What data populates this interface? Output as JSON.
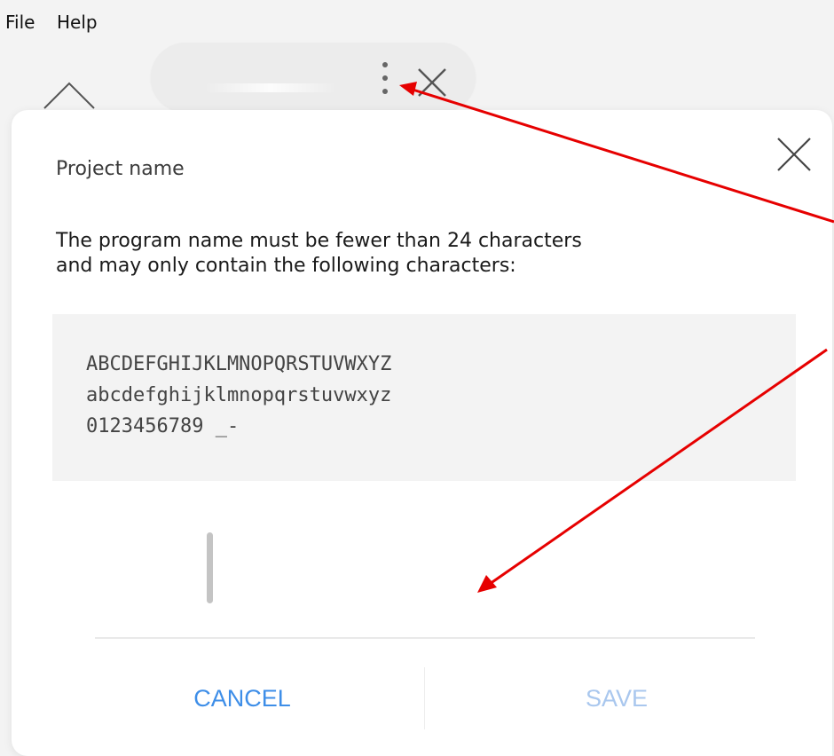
{
  "menu": {
    "file": "File",
    "help": "Help"
  },
  "dialog": {
    "title": "Project name",
    "description_line1": "The program name must be fewer than 24 characters",
    "description_line2": "and may only contain the following characters:",
    "allowed_chars": {
      "uppercase": "ABCDEFGHIJKLMNOPQRSTUVWXYZ",
      "lowercase": "abcdefghijklmnopqrstuvwxyz",
      "digits_symbols": "0123456789 _-"
    },
    "input_value": "",
    "cancel_label": "CANCEL",
    "save_label": "SAVE"
  },
  "colors": {
    "accent": "#3e8ee8",
    "disabled_accent": "#a9c7ee",
    "annotation_arrow": "#e60000"
  },
  "icons": [
    "chevron-up-icon",
    "more-vertical-icon",
    "close-icon"
  ]
}
